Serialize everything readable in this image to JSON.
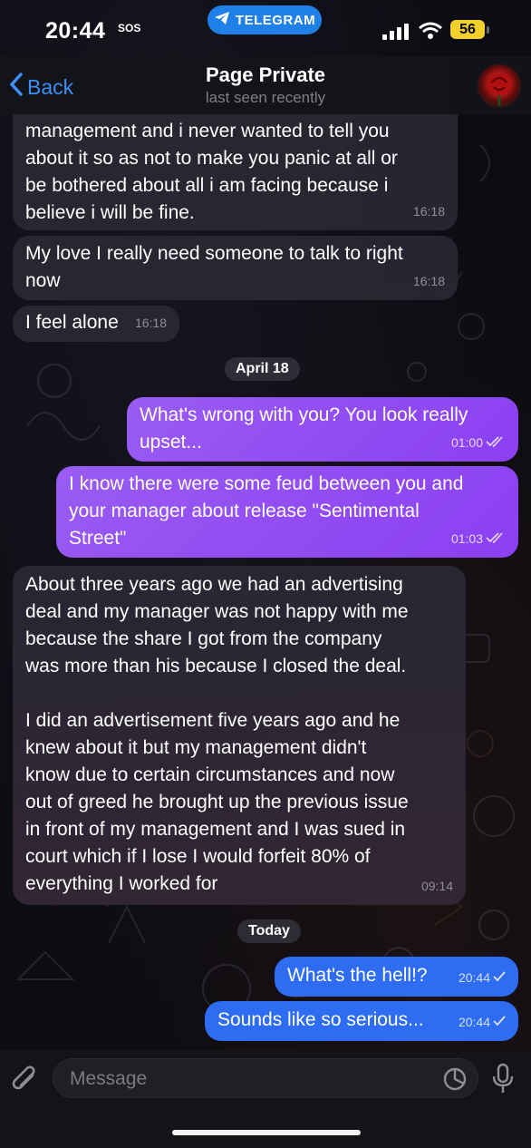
{
  "status_bar": {
    "time": "20:44",
    "sos": "SOS",
    "pill_label": "TELEGRAM",
    "battery": "56"
  },
  "header": {
    "back_label": "Back",
    "title": "Page Private",
    "subtitle": "last seen recently"
  },
  "messages": [
    {
      "text": "management and i never wanted to tell you\nabout it so as not to make you panic at all or\nbe bothered about all i am facing because i\nbelieve i will be fine.",
      "time": "16:18"
    },
    {
      "text": "My love I really need someone to talk to right\nnow",
      "time": "16:18"
    },
    {
      "text": "I feel alone",
      "time": "16:18"
    },
    {
      "text": "What's wrong with you? You look really\nupset...",
      "time": "01:00"
    },
    {
      "text": "I know there were some feud between you and\nyour manager about release \"Sentimental\nStreet\"",
      "time": "01:03"
    },
    {
      "text": "About three years ago we had an advertising\ndeal and my manager was not happy with me\nbecause the share I got from the company\nwas more than his because I closed the deal.\n\nI did an advertisement five years ago and he\nknew about it but my management didn't\nknow due to certain circumstances and now\nout of greed he brought up the previous issue\nin front of my management and I was sued in\ncourt which if I lose I would forfeit 80% of\neverything I worked for",
      "time": "09:14"
    },
    {
      "text": "What's the hell!?",
      "time": "20:44"
    },
    {
      "text": "Sounds like so serious...",
      "time": "20:44"
    }
  ],
  "date_separators": [
    "April 18",
    "Today"
  ],
  "input": {
    "placeholder": "Message"
  },
  "colors": {
    "accent": "#3b8ff6",
    "outgoing_purple": "#8b3ff2",
    "outgoing_blue": "#2e6cf2",
    "incoming": "#28283a"
  }
}
